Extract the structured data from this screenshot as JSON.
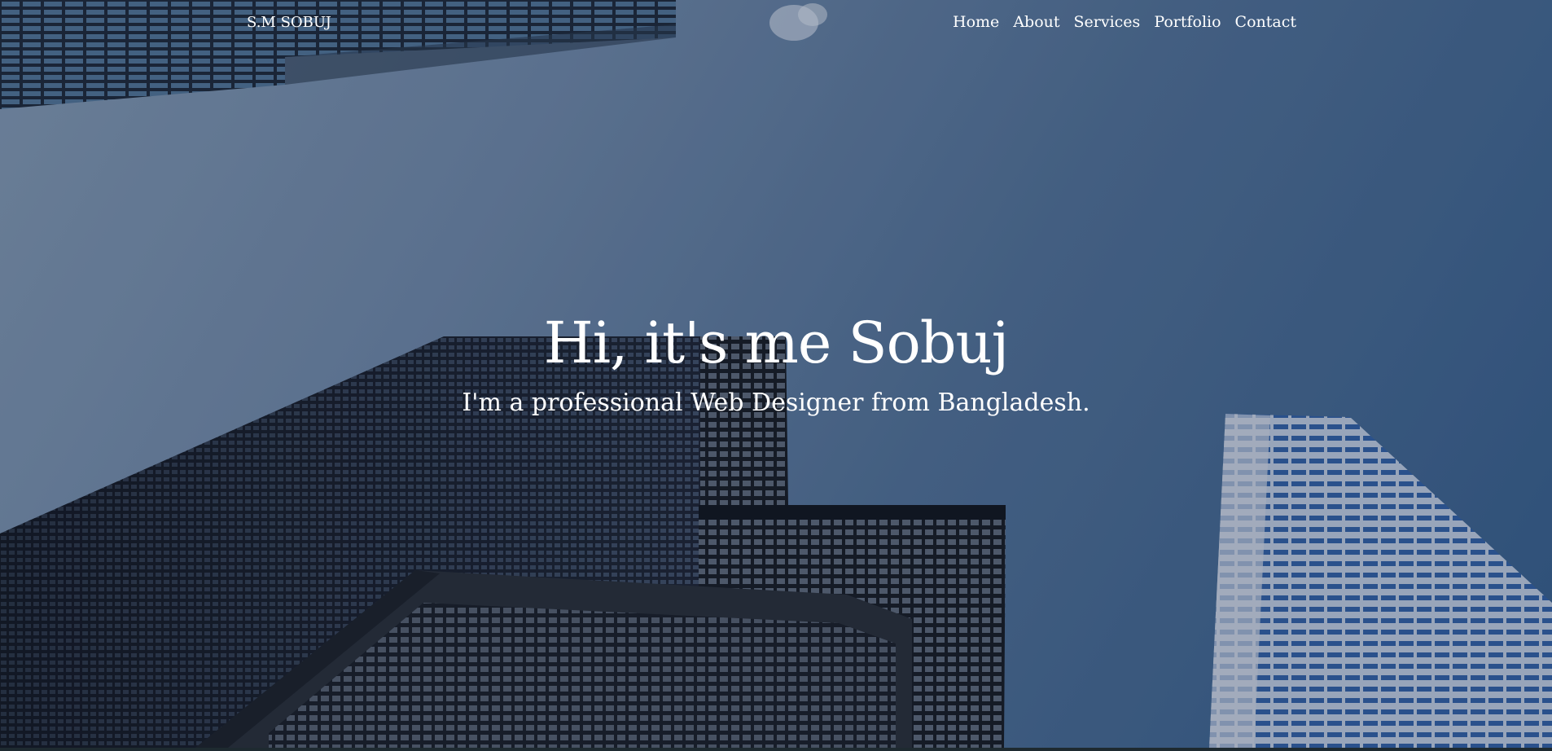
{
  "brand": {
    "name": "S.M SOBUJ"
  },
  "nav": {
    "items": [
      "Home",
      "About",
      "Services",
      "Portfolio",
      "Contact"
    ]
  },
  "hero": {
    "headline": "Hi, it's me Sobuj",
    "subline": "I'm a professional Web Designer from Bangladesh."
  },
  "colors": {
    "text": "#ffffff",
    "sky_light": "#7d93ab",
    "sky_dark": "#335a86"
  },
  "icons": {
    "background": "city-skyscrapers-photo"
  }
}
